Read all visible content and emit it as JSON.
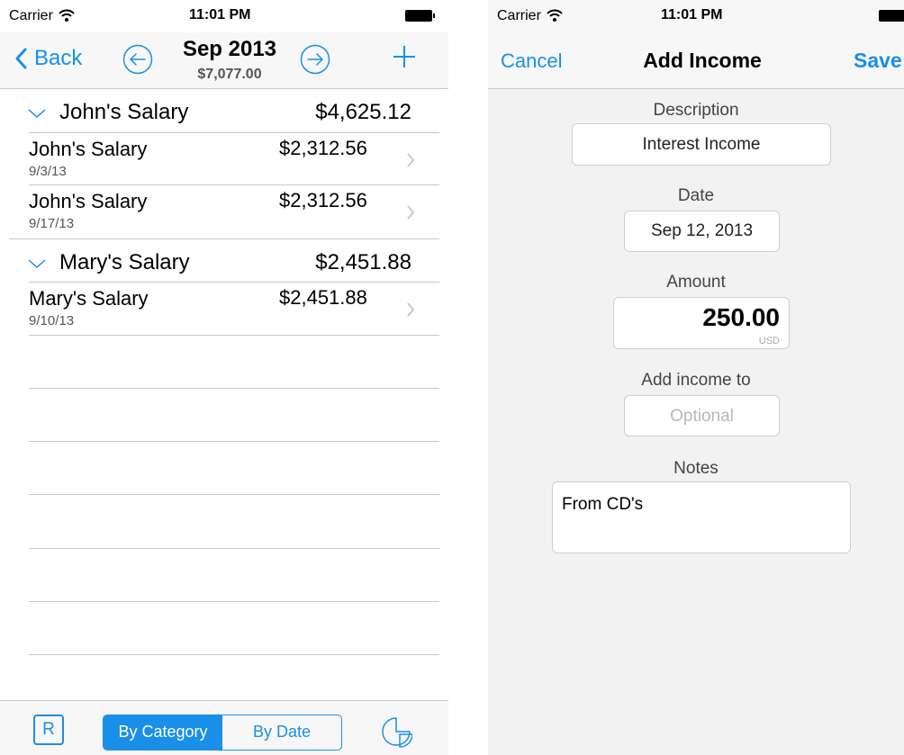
{
  "left_screen": {
    "status": {
      "carrier": "Carrier",
      "time": "11:01 PM"
    },
    "nav": {
      "back_label": "Back",
      "title": "Sep 2013",
      "subtitle": "$7,077.00"
    },
    "groups": [
      {
        "label": "John's Salary",
        "amount": "$4,625.12",
        "items": [
          {
            "label": "John's Salary",
            "date": "9/3/13",
            "amount": "$2,312.56"
          },
          {
            "label": "John's Salary",
            "date": "9/17/13",
            "amount": "$2,312.56"
          }
        ]
      },
      {
        "label": "Mary's Salary",
        "amount": "$2,451.88",
        "items": [
          {
            "label": "Mary's Salary",
            "date": "9/10/13",
            "amount": "$2,451.88"
          }
        ]
      }
    ],
    "toolbar": {
      "r_label": "R",
      "seg_by_category": "By Category",
      "seg_by_date": "By Date",
      "selected": "By Category"
    }
  },
  "right_screen": {
    "status": {
      "carrier": "Carrier",
      "time": "11:01 PM"
    },
    "nav": {
      "cancel_label": "Cancel",
      "title": "Add Income",
      "save_label": "Save"
    },
    "form": {
      "description_label": "Description",
      "description_value": "Interest Income",
      "date_label": "Date",
      "date_value": "Sep 12, 2013",
      "amount_label": "Amount",
      "amount_value": "250.00",
      "amount_currency": "USD",
      "add_income_to_label": "Add income to",
      "add_income_to_placeholder": "Optional",
      "notes_label": "Notes",
      "notes_value": "From CD's"
    }
  },
  "colors": {
    "accent": "#1a8fe8",
    "separator": "#c8c7cc",
    "form_background": "#f2f2f2"
  },
  "icons": [
    "wifi-icon",
    "battery-icon",
    "back-chevron-icon",
    "prev-month-icon",
    "next-month-icon",
    "add-icon",
    "chevron-down-icon",
    "chevron-right-icon",
    "pie-chart-icon"
  ]
}
